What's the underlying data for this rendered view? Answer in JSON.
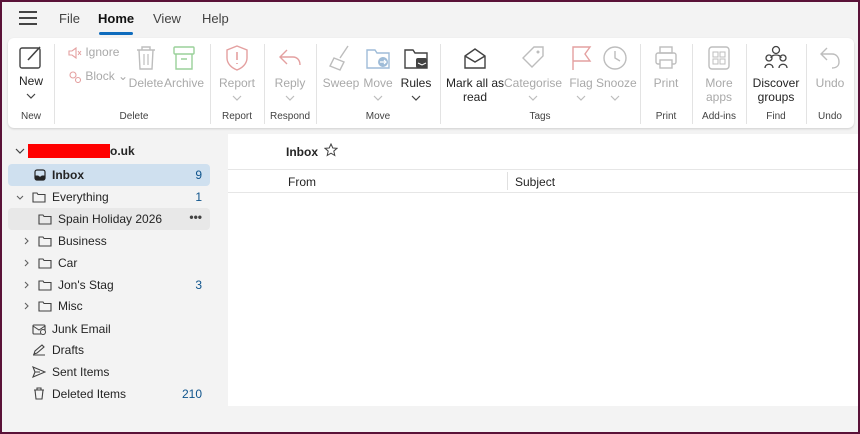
{
  "menubar": {
    "items": [
      "File",
      "Home",
      "View",
      "Help"
    ],
    "active": "Home"
  },
  "ribbon": {
    "new": {
      "label": "New",
      "group": "New"
    },
    "delete_group": {
      "ignore": "Ignore",
      "block": "Block",
      "delete": "Delete",
      "archive": "Archive",
      "group": "Delete"
    },
    "report": {
      "label": "Report",
      "group": "Report"
    },
    "reply": {
      "label": "Reply",
      "group": "Respond"
    },
    "move_group": {
      "sweep": "Sweep",
      "move": "Move",
      "rules": "Rules",
      "group": "Move"
    },
    "tags_group": {
      "mark_all_line1": "Mark all as",
      "mark_all_line2": "read",
      "categorise": "Categorise",
      "flag": "Flag",
      "snooze": "Snooze",
      "group": "Tags"
    },
    "print": {
      "label": "Print",
      "group": "Print"
    },
    "more_apps": {
      "line1": "More",
      "line2": "apps",
      "group": "Add-ins"
    },
    "discover": {
      "line1": "Discover",
      "line2": "groups",
      "group": "Find"
    },
    "undo": {
      "label": "Undo",
      "group": "Undo"
    }
  },
  "folders": {
    "account_suffix": "o.uk",
    "items": [
      {
        "label": "Inbox",
        "count": "9"
      },
      {
        "label": "Everything",
        "count": "1"
      },
      {
        "label": "Spain Holiday 2026",
        "count": "•••"
      },
      {
        "label": "Business",
        "count": ""
      },
      {
        "label": "Car",
        "count": ""
      },
      {
        "label": "Jon's Stag",
        "count": "3"
      },
      {
        "label": "Misc",
        "count": ""
      },
      {
        "label": "Junk Email",
        "count": ""
      },
      {
        "label": "Drafts",
        "count": ""
      },
      {
        "label": "Sent Items",
        "count": ""
      },
      {
        "label": "Deleted Items",
        "count": "210"
      }
    ]
  },
  "message_list": {
    "title": "Inbox",
    "columns": [
      "From",
      "Subject"
    ]
  },
  "colors": {
    "accent": "#0f6cbd",
    "selected_row": "#cfe0ef",
    "frame": "#5a1238"
  }
}
